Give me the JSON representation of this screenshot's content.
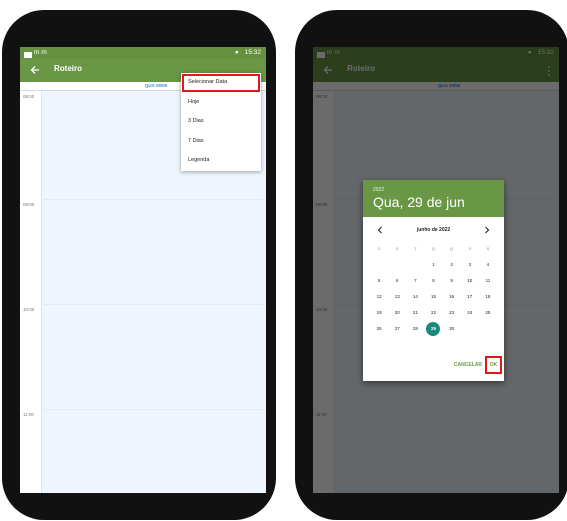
{
  "status_bar": {
    "time": "15:32"
  },
  "app_bar": {
    "title": "Roteiro"
  },
  "day_header": "QUA 29/06",
  "hours": [
    "08:00",
    "09:00",
    "10:00",
    "11:00"
  ],
  "menu": {
    "items": [
      "Selecionar Data",
      "Hoje",
      "3 Dias",
      "7 Dias",
      "Legenda"
    ]
  },
  "dialog": {
    "year": "2022",
    "date": "Qua, 29 de jun",
    "month": "junho de 2022",
    "weekdays": [
      "D",
      "S",
      "T",
      "Q",
      "Q",
      "S",
      "S"
    ],
    "days": [
      "",
      "",
      "",
      "1",
      "2",
      "3",
      "4",
      "5",
      "6",
      "7",
      "8",
      "9",
      "10",
      "11",
      "12",
      "13",
      "14",
      "15",
      "16",
      "17",
      "18",
      "19",
      "20",
      "21",
      "22",
      "23",
      "24",
      "25",
      "26",
      "27",
      "28",
      "29",
      "30",
      "",
      ""
    ],
    "selected_day": "29",
    "cancel": "CANCELAR",
    "ok": "OK"
  },
  "colors": {
    "appbar": "#6a9746",
    "selected": "#1a8a7c",
    "highlight": "#e0191b",
    "event_area": "#eef5fd",
    "day_header_text": "#3c8fd6"
  }
}
